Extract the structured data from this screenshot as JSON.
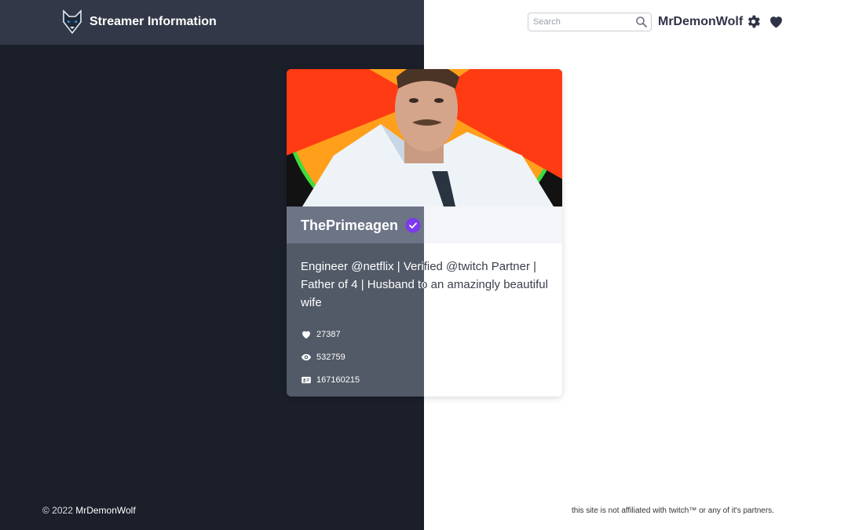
{
  "header": {
    "brand_title": "Streamer Information",
    "search_placeholder": "Search",
    "username": "MrDemonWolf",
    "icons": [
      "wolf-logo-icon",
      "search-icon",
      "gear-icon",
      "heart-icon"
    ]
  },
  "card": {
    "streamer_name": "ThePrimeagen",
    "verified": true,
    "bio": "Engineer @netflix | Verified @twitch Partner | Father of 4 | Husband to an amazingly beautiful wife",
    "stats": [
      {
        "icon": "heart-icon",
        "value": "27387"
      },
      {
        "icon": "eye-icon",
        "value": "532759"
      },
      {
        "icon": "id-card-icon",
        "value": "167160215"
      }
    ]
  },
  "footer": {
    "copyright_prefix": "© 2022",
    "copyright_owner": "MrDemonWolf",
    "disclaimer": "this site is not affiliated with twitch™ or any of it's partners."
  },
  "colors": {
    "dark_bg": "#1b1f2a",
    "dark_header": "#323847",
    "accent_purple": "#7c3aed",
    "avatar_ring": "#3ddc3d"
  }
}
